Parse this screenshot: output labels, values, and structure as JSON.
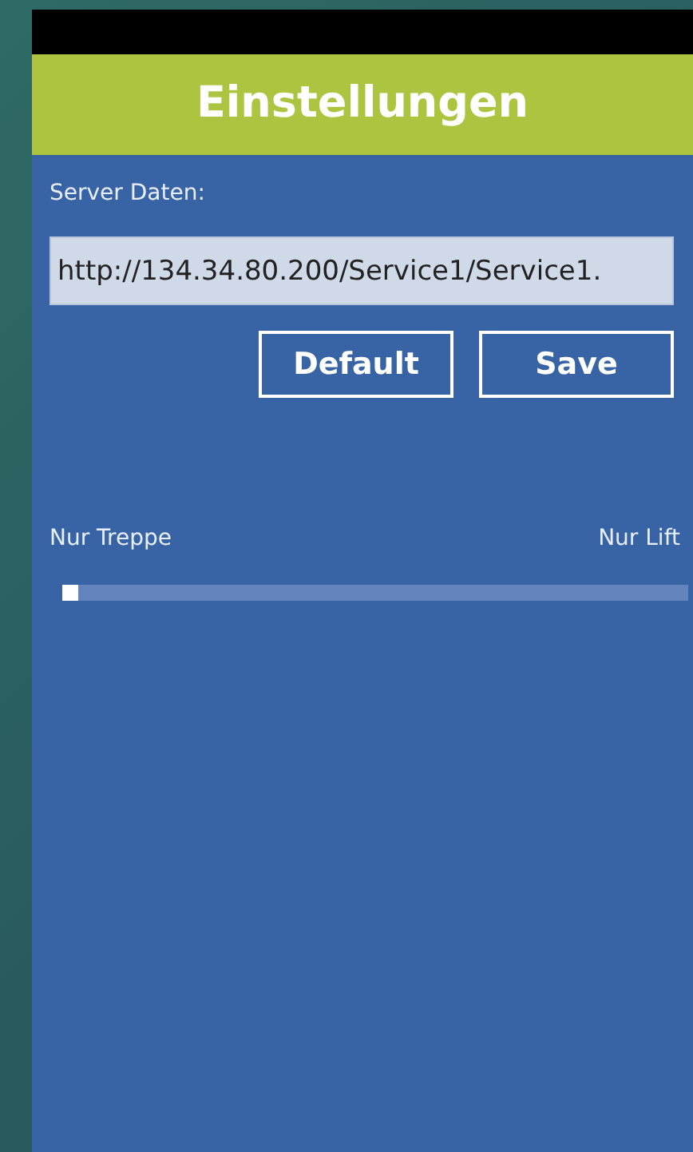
{
  "header": {
    "title": "Einstellungen"
  },
  "server": {
    "label": "Server Daten:",
    "value": "http://134.34.80.200/Service1/Service1."
  },
  "buttons": [
    {
      "label": "Default"
    },
    {
      "label": "Save"
    }
  ],
  "slider": {
    "min_label": "Nur Treppe",
    "max_label": "Nur Lift",
    "level": 0
  }
}
